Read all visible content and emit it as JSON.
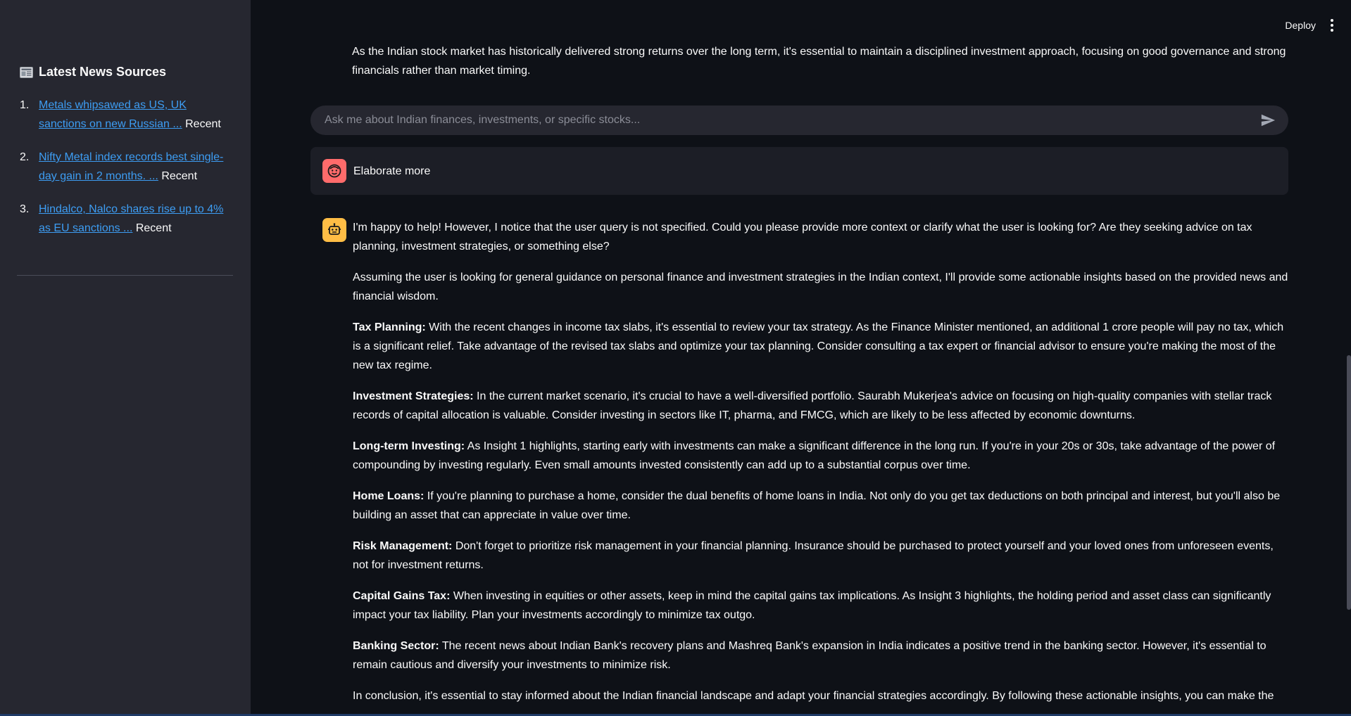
{
  "sidebar": {
    "heading": "Latest News Sources",
    "heading_icon": "newspaper-icon",
    "items": [
      {
        "num": "1.",
        "link": "Metals whipsawed as US, UK sanctions on new Russian ...",
        "tag": "Recent"
      },
      {
        "num": "2.",
        "link": "Nifty Metal index records best single-day gain in 2 months. ...",
        "tag": "Recent"
      },
      {
        "num": "3.",
        "link": "Hindalco, Nalco shares rise up to 4% as EU sanctions ...",
        "tag": "Recent"
      }
    ]
  },
  "header": {
    "deploy_label": "Deploy",
    "menu_icon": "kebab-menu-icon"
  },
  "intro_text": "As the Indian stock market has historically delivered strong returns over the long term, it's essential to maintain a disciplined investment approach, focusing on good governance and strong financials rather than market timing.",
  "chat_input": {
    "placeholder": "Ask me about Indian finances, investments, or specific stocks..."
  },
  "user_message": {
    "text": "Elaborate more"
  },
  "assistant": {
    "p1": "I'm happy to help! However, I notice that the user query is not specified. Could you please provide more context or clarify what the user is looking for? Are they seeking advice on tax planning, investment strategies, or something else?",
    "p2": "Assuming the user is looking for general guidance on personal finance and investment strategies in the Indian context, I'll provide some actionable insights based on the provided news and financial wisdom.",
    "sections": [
      {
        "title": "Tax Planning:",
        "text": " With the recent changes in income tax slabs, it's essential to review your tax strategy. As the Finance Minister mentioned, an additional 1 crore people will pay no tax, which is a significant relief. Take advantage of the revised tax slabs and optimize your tax planning. Consider consulting a tax expert or financial advisor to ensure you're making the most of the new tax regime."
      },
      {
        "title": "Investment Strategies:",
        "text": " In the current market scenario, it's crucial to have a well-diversified portfolio. Saurabh Mukerjea's advice on focusing on high-quality companies with stellar track records of capital allocation is valuable. Consider investing in sectors like IT, pharma, and FMCG, which are likely to be less affected by economic downturns."
      },
      {
        "title": "Long-term Investing:",
        "text": " As Insight 1 highlights, starting early with investments can make a significant difference in the long run. If you're in your 20s or 30s, take advantage of the power of compounding by investing regularly. Even small amounts invested consistently can add up to a substantial corpus over time."
      },
      {
        "title": "Home Loans:",
        "text": " If you're planning to purchase a home, consider the dual benefits of home loans in India. Not only do you get tax deductions on both principal and interest, but you'll also be building an asset that can appreciate in value over time."
      },
      {
        "title": "Risk Management:",
        "text": " Don't forget to prioritize risk management in your financial planning. Insurance should be purchased to protect yourself and your loved ones from unforeseen events, not for investment returns."
      },
      {
        "title": "Capital Gains Tax:",
        "text": " When investing in equities or other assets, keep in mind the capital gains tax implications. As Insight 3 highlights, the holding period and asset class can significantly impact your tax liability. Plan your investments accordingly to minimize tax outgo."
      },
      {
        "title": "Banking Sector:",
        "text": " The recent news about Indian Bank's recovery plans and Mashreq Bank's expansion in India indicates a positive trend in the banking sector. However, it's essential to remain cautious and diversify your investments to minimize risk."
      }
    ],
    "conclusion": "In conclusion, it's essential to stay informed about the Indian financial landscape and adapt your financial strategies accordingly. By following these actionable insights, you can make the"
  }
}
